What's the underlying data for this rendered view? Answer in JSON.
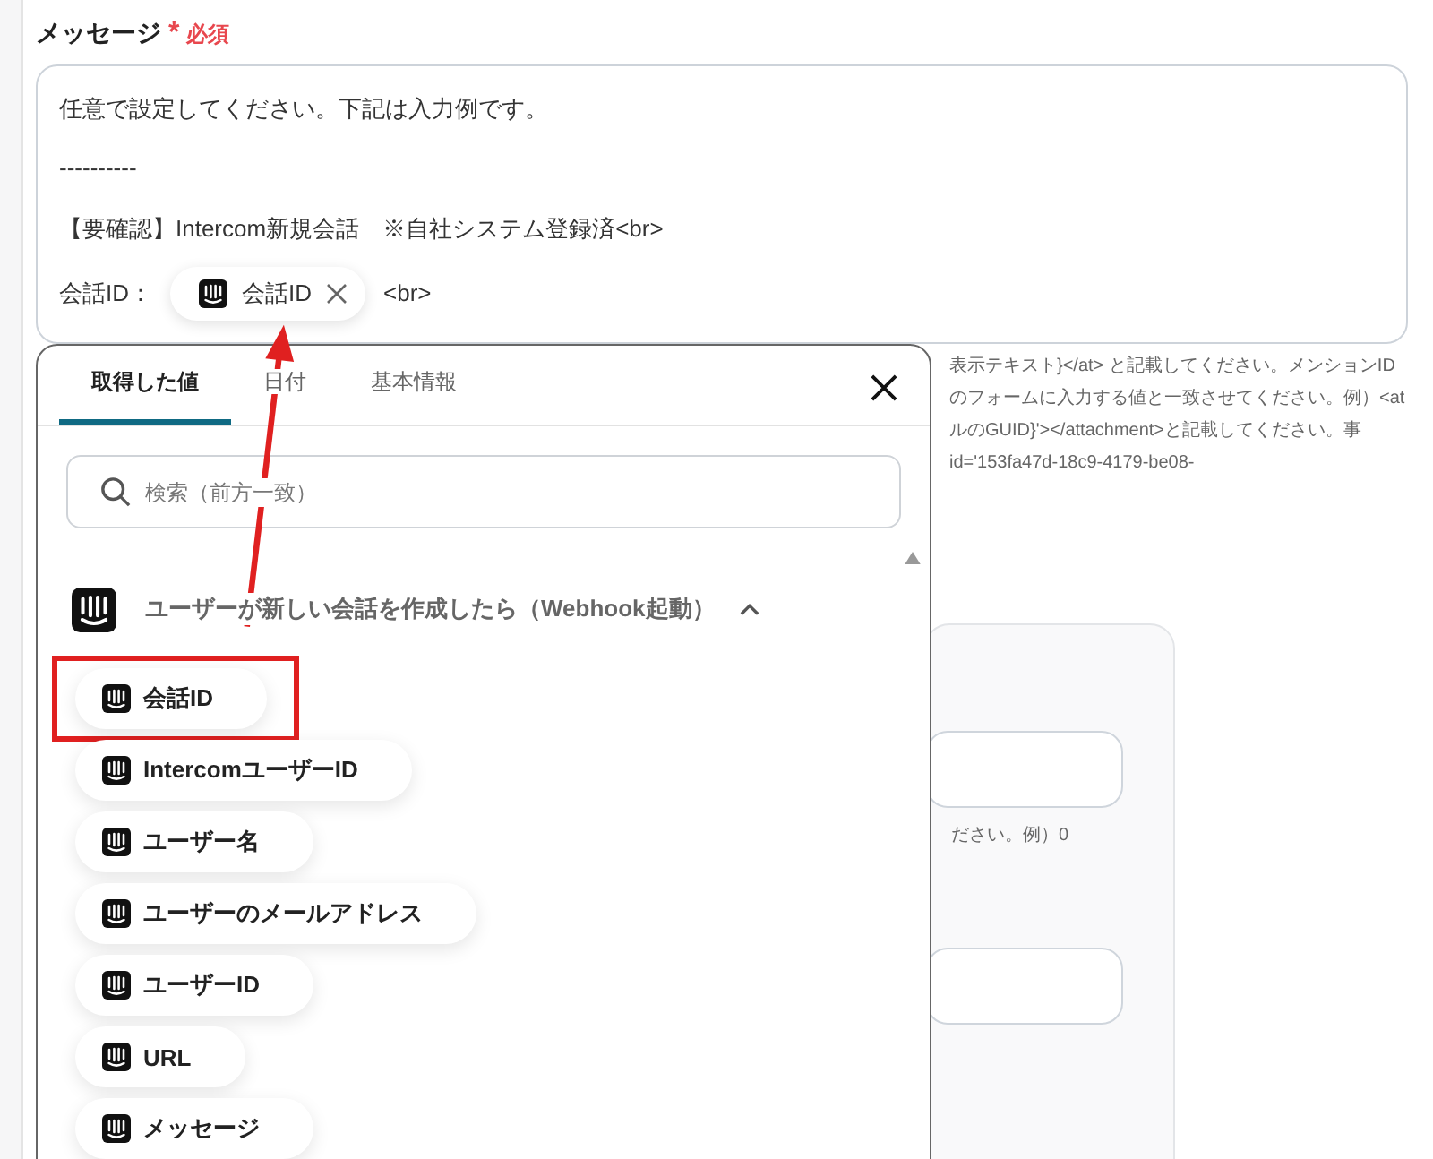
{
  "field": {
    "label": "メッセージ",
    "required_mark": "*",
    "required": "必須"
  },
  "textarea": {
    "lines": [
      "任意で設定してください。下記は入力例です。",
      "----------",
      "【要確認】Intercom新規会話　※自社システム登録済<br>"
    ],
    "token_line": {
      "prefix": "会話ID：",
      "chip": "会話ID",
      "suffix": "<br>"
    }
  },
  "help_lines": [
    "表示テキスト}</at> と記載してください。メンションID",
    "のフォームに入力する値と一致させてください。例）<at",
    "ルのGUID}'></attachment>と記載してください。事",
    "id='153fa47d-18c9-4179-be08-"
  ],
  "panel_hint": "ださい。例）0",
  "popup": {
    "tabs": [
      {
        "label": "取得した値",
        "selected": true
      },
      {
        "label": "日付",
        "selected": false
      },
      {
        "label": "基本情報",
        "selected": false
      }
    ],
    "search": {
      "placeholder": "検索（前方一致）"
    },
    "group": {
      "title": "ユーザーが新しい会話を作成したら（Webhook起動）",
      "expanded": true
    },
    "items": [
      {
        "label": "会話ID",
        "annotated": true
      },
      {
        "label": "IntercomユーザーID",
        "annotated": false
      },
      {
        "label": "ユーザー名",
        "annotated": false
      },
      {
        "label": "ユーザーのメールアドレス",
        "annotated": false
      },
      {
        "label": "ユーザーID",
        "annotated": false
      },
      {
        "label": "URL",
        "annotated": false
      },
      {
        "label": "メッセージ",
        "annotated": false
      }
    ]
  }
}
